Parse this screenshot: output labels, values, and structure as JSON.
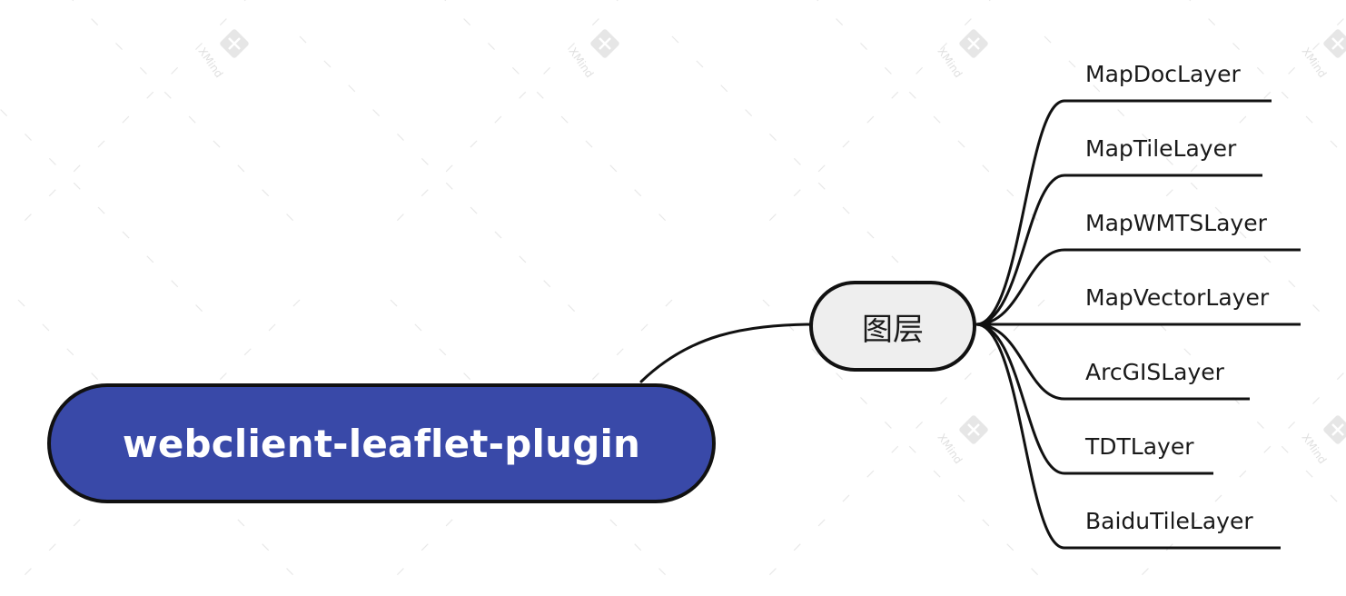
{
  "root": {
    "label": "webclient-leaflet-plugin"
  },
  "main_topic": {
    "label": "图层"
  },
  "subtopics": [
    "MapDocLayer",
    "MapTileLayer",
    "MapWMTSLayer",
    "MapVectorLayer",
    "ArcGISLayer",
    "TDTLayer",
    "BaiduTileLayer"
  ],
  "watermark": {
    "brand": "XMind",
    "icon": "xmind-x-logo-icon"
  },
  "colors": {
    "root_fill": "#3949a8",
    "main_fill": "#eeeeee",
    "line": "#111111",
    "text": "#1a1a1a"
  }
}
